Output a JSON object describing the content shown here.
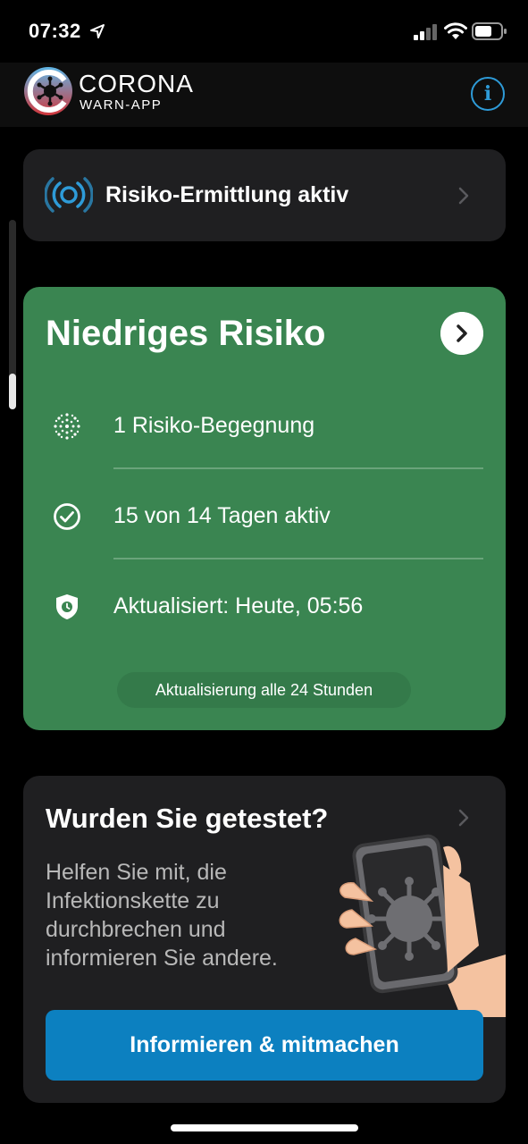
{
  "status_bar": {
    "time": "07:32"
  },
  "header": {
    "brand_title": "CORONA",
    "brand_subtitle": "WARN-APP",
    "info_label": "i"
  },
  "tracing_card": {
    "label": "Risiko-Ermittlung aktiv"
  },
  "risk_card": {
    "title": "Niedriges Risiko",
    "rows": [
      {
        "icon": "virus-dots-icon",
        "text": "1 Risiko-Begegnung"
      },
      {
        "icon": "check-circle-icon",
        "text": "15 von 14 Tagen aktiv"
      },
      {
        "icon": "shield-clock-icon",
        "text": "Aktualisiert: Heute, 05:56"
      }
    ],
    "update_interval": "Aktualisierung alle 24 Stunden"
  },
  "test_card": {
    "title": "Wurden Sie getestet?",
    "body": "Helfen Sie mit, die Infektionskette zu durchbrechen und informieren Sie andere.",
    "button_label": "Informieren & mitmachen"
  },
  "colors": {
    "background": "#000000",
    "card_dark": "#1f1f21",
    "risk_green": "#3a8551",
    "accent_blue": "#0c80c0",
    "info_blue": "#2e9bd8"
  }
}
